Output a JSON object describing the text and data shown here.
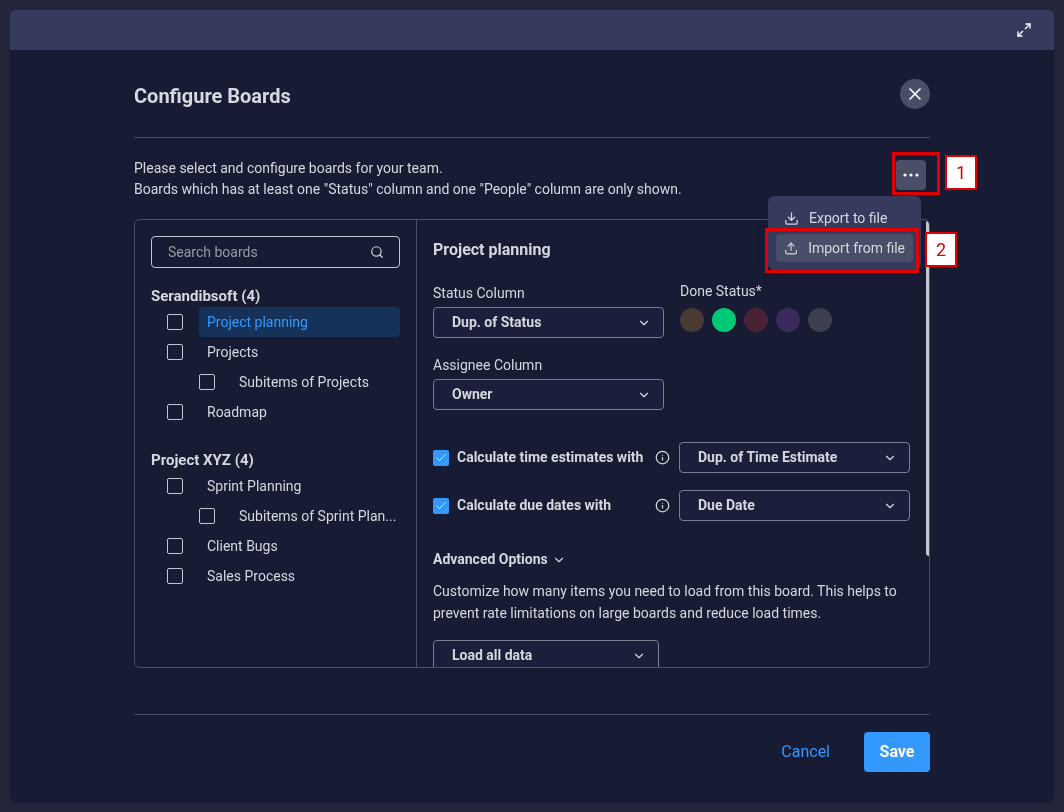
{
  "dialog": {
    "title": "Configure Boards",
    "description": [
      "Please select and configure boards for your team.",
      "Boards which has at least one \"Status\" column and one \"People\" column are only shown."
    ]
  },
  "more_button": {
    "callout": "1"
  },
  "menu": {
    "items": [
      {
        "kind": "export",
        "label": "Export to file",
        "selected": false
      },
      {
        "kind": "import",
        "label": "Import from file",
        "selected": true,
        "callout": "2"
      }
    ]
  },
  "search": {
    "placeholder": "Search boards"
  },
  "groups": [
    {
      "title": "Serandibsoft (4)",
      "items": [
        {
          "label": "Project planning",
          "checked": false,
          "selected": true
        },
        {
          "label": "Projects",
          "checked": false,
          "selected": false,
          "children": [
            {
              "label": "Subitems of Projects",
              "checked": false,
              "selected": false
            }
          ]
        },
        {
          "label": "Roadmap",
          "checked": false,
          "selected": false
        }
      ]
    },
    {
      "title": "Project XYZ (4)",
      "items": [
        {
          "label": "Sprint Planning",
          "checked": false,
          "selected": false,
          "children": [
            {
              "label": "Subitems of Sprint Plan...",
              "checked": false,
              "selected": false
            }
          ]
        },
        {
          "label": "Client Bugs",
          "checked": false,
          "selected": false
        },
        {
          "label": "Sales Process",
          "checked": false,
          "selected": false
        }
      ]
    }
  ],
  "detail": {
    "title": "Project planning",
    "status_column": {
      "label": "Status Column",
      "value": "Dup. of Status"
    },
    "done_status": {
      "label": "Done Status*",
      "options": [
        {
          "color": "#4a3a33"
        },
        {
          "color": "#00c875"
        },
        {
          "color": "#4a2236"
        },
        {
          "color": "#3a2a5c"
        },
        {
          "color": "#3e3f52"
        }
      ]
    },
    "assignee_column": {
      "label": "Assignee Column",
      "value": "Owner"
    },
    "options": [
      {
        "label": "Calculate time estimates with",
        "checked": true,
        "value": "Dup. of Time Estimate"
      },
      {
        "label": "Calculate due dates with",
        "checked": true,
        "value": "Due Date"
      }
    ],
    "advanced": {
      "label": "Advanced Options",
      "expanded": true,
      "text": "Customize how many items you need to load from this board. This helps to prevent rate limitations on large boards and reduce load times.",
      "value": "Load all data"
    }
  },
  "buttons": {
    "cancel": "Cancel",
    "save": "Save"
  }
}
